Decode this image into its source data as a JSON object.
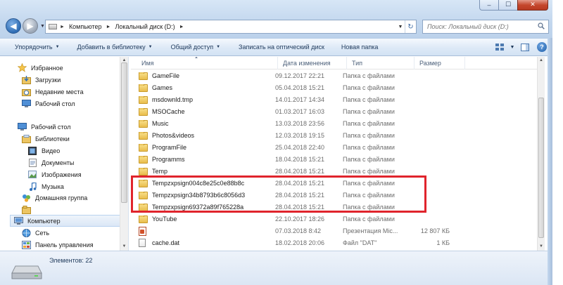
{
  "window": {
    "caption_min": "–",
    "caption_max": "☐",
    "caption_close": "✕"
  },
  "nav": {
    "back_icon": "back-arrow-icon",
    "forward_icon": "forward-arrow-icon"
  },
  "address": {
    "breadcrumb": [
      "Компьютер",
      "Локальный диск (D:)"
    ]
  },
  "search": {
    "placeholder": "Поиск: Локальный диск (D:)"
  },
  "toolbar": {
    "organize": "Упорядочить",
    "include_library": "Добавить в библиотеку",
    "share": "Общий доступ",
    "burn": "Записать на оптический диск",
    "new_folder": "Новая папка"
  },
  "sidebar": {
    "favorites": "Избранное",
    "downloads": "Загрузки",
    "recent": "Недавние места",
    "desktop_fav": "Рабочий стол",
    "desktop": "Рабочий стол",
    "libraries": "Библиотеки",
    "video": "Видео",
    "documents": "Документы",
    "pictures": "Изображения",
    "music": "Музыка",
    "homegroup": "Домашняя группа",
    "computer": "Компьютер",
    "network": "Сеть",
    "control_panel": "Панель управления"
  },
  "columns": {
    "name": "Имя",
    "date": "Дата изменения",
    "type": "Тип",
    "size": "Размер"
  },
  "files": [
    {
      "name": "GameFile",
      "date": "09.12.2017 22:21",
      "type": "Папка с файлами",
      "size": "",
      "icon": "folder"
    },
    {
      "name": "Games",
      "date": "05.04.2018 15:21",
      "type": "Папка с файлами",
      "size": "",
      "icon": "folder"
    },
    {
      "name": "msdownld.tmp",
      "date": "14.01.2017 14:34",
      "type": "Папка с файлами",
      "size": "",
      "icon": "folder"
    },
    {
      "name": "MSOCache",
      "date": "01.03.2017 16:03",
      "type": "Папка с файлами",
      "size": "",
      "icon": "folder"
    },
    {
      "name": "Music",
      "date": "13.03.2018 23:56",
      "type": "Папка с файлами",
      "size": "",
      "icon": "folder"
    },
    {
      "name": "Photos&videos",
      "date": "12.03.2018 19:15",
      "type": "Папка с файлами",
      "size": "",
      "icon": "folder"
    },
    {
      "name": "ProgramFile",
      "date": "25.04.2018 22:40",
      "type": "Папка с файлами",
      "size": "",
      "icon": "folder"
    },
    {
      "name": "Programms",
      "date": "18.04.2018 15:21",
      "type": "Папка с файлами",
      "size": "",
      "icon": "folder"
    },
    {
      "name": "Temp",
      "date": "28.04.2018 15:21",
      "type": "Папка с файлами",
      "size": "",
      "icon": "folder"
    },
    {
      "name": "Tempzxpsign004c8e25c0e88b8c",
      "date": "28.04.2018 15:21",
      "type": "Папка с файлами",
      "size": "",
      "icon": "folder"
    },
    {
      "name": "Tempzxpsign34b8793b6c8056d3",
      "date": "28.04.2018 15:21",
      "type": "Папка с файлами",
      "size": "",
      "icon": "folder"
    },
    {
      "name": "Tempzxpsign69372a89f765228a",
      "date": "28.04.2018 15:21",
      "type": "Папка с файлами",
      "size": "",
      "icon": "folder"
    },
    {
      "name": "YouTube",
      "date": "22.10.2017 18:26",
      "type": "Папка с файлами",
      "size": "",
      "icon": "folder"
    },
    {
      "name": "",
      "date": "07.03.2018 8:42",
      "type": "Презентация Mic...",
      "size": "12 807 КБ",
      "icon": "powerpoint"
    },
    {
      "name": "cache.dat",
      "date": "18.02.2018 20:06",
      "type": "Файл \"DAT\"",
      "size": "1 КБ",
      "icon": "file"
    }
  ],
  "status": {
    "items": "Элементов: 22"
  },
  "colors": {
    "highlight": "#e0242c",
    "accent": "#1e395b"
  }
}
